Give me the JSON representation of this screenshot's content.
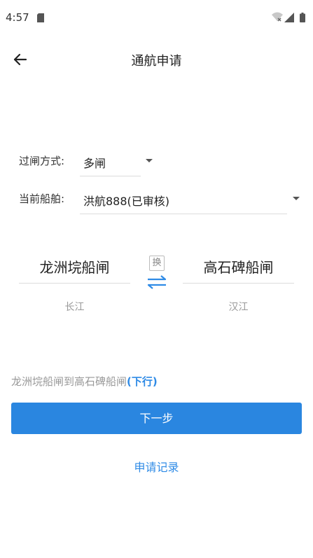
{
  "status_bar": {
    "time": "4:57"
  },
  "header": {
    "title": "通航申请"
  },
  "form": {
    "pass_mode_label": "过闸方式:",
    "pass_mode_value": "多闸",
    "ship_label": "当前船舶:",
    "ship_value": "洪航888(已审核)"
  },
  "route": {
    "from_station": "龙洲垸船闸",
    "from_river": "长江",
    "swap_label": "换",
    "to_station": "高石碑船闸",
    "to_river": "汉江",
    "summary": "龙洲垸船闸到高石碑船闸",
    "direction": "(下行)"
  },
  "actions": {
    "next_label": "下一步",
    "records_label": "申请记录"
  },
  "colors": {
    "accent": "#2a86e0",
    "link": "#2f8be6"
  }
}
